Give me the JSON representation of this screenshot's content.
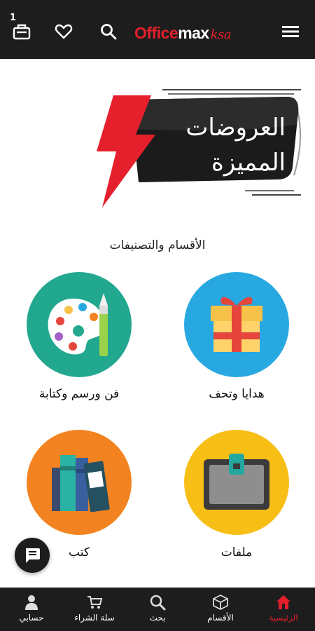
{
  "header": {
    "cart_count": "1",
    "logo_office": "Office",
    "logo_max": "max",
    "logo_suffix": "ksa"
  },
  "banner": {
    "line1": "العروضات",
    "line2": "المميزة"
  },
  "categories_section": {
    "title": "الأقسام والتصنيفات",
    "items": [
      {
        "label": "هدايا وتحف",
        "icon": "gift-icon",
        "color": "#27a8e0"
      },
      {
        "label": "فن ورسم وكتابة",
        "icon": "palette-icon",
        "color": "#23a890"
      },
      {
        "label": "ملفات",
        "icon": "folder-icon",
        "color": "#f7be16"
      },
      {
        "label": "كتب",
        "icon": "books-icon",
        "color": "#f28320"
      }
    ]
  },
  "bottom_nav": {
    "items": [
      {
        "label": "الرئيسية",
        "icon": "home-icon",
        "active": true
      },
      {
        "label": "الأقسام",
        "icon": "categories-icon",
        "active": false
      },
      {
        "label": "بحث",
        "icon": "search-icon",
        "active": false
      },
      {
        "label": "سلة الشراء",
        "icon": "cart-icon",
        "active": false
      },
      {
        "label": "حسابي",
        "icon": "user-icon",
        "active": false
      }
    ]
  },
  "colors": {
    "brand_red": "#e5202c",
    "dark": "#1d1d1d"
  }
}
